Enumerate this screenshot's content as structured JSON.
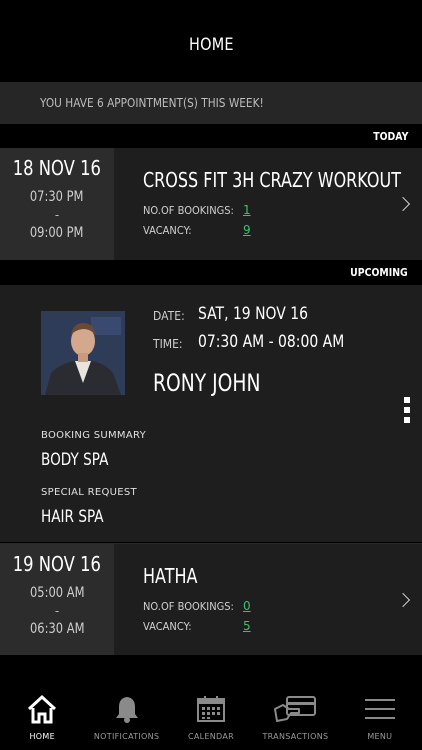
{
  "header": {
    "title": "HOME"
  },
  "banner": {
    "text": "YOU HAVE 6 APPOINTMENT(S) THIS WEEK!"
  },
  "sections": {
    "today": "TODAY",
    "upcoming": "UPCOMING"
  },
  "today_card": {
    "date": "18 NOV 16",
    "start_time": "07:30 PM",
    "dash": "-",
    "end_time": "09:00 PM",
    "title": "CROSS FIT 3H CRAZY WORKOUT",
    "bookings_label": "NO.OF BOOKINGS:",
    "bookings_value": "1",
    "vacancy_label": "VACANCY:",
    "vacancy_value": "9"
  },
  "upcoming_detail": {
    "date_label": "DATE:",
    "date_value": "SAT, 19 NOV 16",
    "time_label": "TIME:",
    "time_value": "07:30 AM - 08:00 AM",
    "name": "RONY JOHN",
    "booking_summary_label": "BOOKING SUMMARY",
    "booking_summary_value": "BODY SPA",
    "special_request_label": "SPECIAL REQUEST",
    "special_request_value": "HAIR SPA"
  },
  "class_card": {
    "date": "19 NOV 16",
    "start_time": "05:00 AM",
    "dash": "-",
    "end_time": "06:30 AM",
    "title": "HATHA",
    "bookings_label": "NO.OF BOOKINGS:",
    "bookings_value": "0",
    "vacancy_label": "VACANCY:",
    "vacancy_value": "5"
  },
  "tabs": [
    {
      "label": "HOME",
      "icon": "home-icon",
      "active": true
    },
    {
      "label": "NOTIFICATIONS",
      "icon": "bell-icon",
      "active": false
    },
    {
      "label": "CALENDAR",
      "icon": "calendar-icon",
      "active": false
    },
    {
      "label": "TRANSACTIONS",
      "icon": "card-payment-icon",
      "active": false
    },
    {
      "label": "MENU",
      "icon": "hamburger-menu-icon",
      "active": false
    }
  ],
  "colors": {
    "accent_green": "#3fbf6a",
    "background": "#000000",
    "card": "#1e1e1e",
    "date_box": "#2c2c2c"
  }
}
